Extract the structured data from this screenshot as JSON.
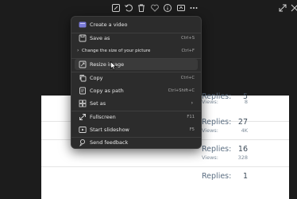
{
  "toolbar": {
    "icons": [
      "edit-icon",
      "rotate-icon",
      "delete-icon",
      "favorite-icon",
      "info-icon",
      "edit-with-icon",
      "more-icon",
      "expand-icon",
      "close-icon"
    ]
  },
  "menu": {
    "create_video": {
      "label": "Create a video",
      "icon": "video-icon"
    },
    "save_as": {
      "label": "Save as",
      "shortcut": "Ctrl+S",
      "icon": "save-icon"
    },
    "change_size": {
      "label": "Change the size of your picture",
      "shortcut": "Ctrl+F"
    },
    "resize_image": {
      "label": "Resize image",
      "icon": "resize-icon"
    },
    "copy": {
      "label": "Copy",
      "shortcut": "Ctrl+C",
      "icon": "copy-icon"
    },
    "copy_as_path": {
      "label": "Copy as path",
      "shortcut": "Ctrl+Shift+C",
      "icon": "copy-path-icon"
    },
    "set_as": {
      "label": "Set as",
      "arrow": "›",
      "icon": "set-as-icon"
    },
    "fullscreen": {
      "label": "Fullscreen",
      "shortcut": "F11",
      "icon": "fullscreen-icon"
    },
    "slideshow": {
      "label": "Start slideshow",
      "shortcut": "F5",
      "icon": "slideshow-icon"
    },
    "feedback": {
      "label": "Send feedback",
      "icon": "feedback-icon"
    }
  },
  "forum": {
    "rows": [
      {
        "replies_label": "Replies:",
        "replies": "5",
        "views_label": "Views:",
        "views": "8"
      },
      {
        "replies_label": "Replies:",
        "replies": "27",
        "views_label": "Views:",
        "views": "4K"
      },
      {
        "replies_label": "Replies:",
        "replies": "16",
        "views_label": "Views:",
        "views": "328"
      },
      {
        "replies_label": "Replies:",
        "replies": "1",
        "views_label": "Views:",
        "views": ""
      }
    ]
  },
  "colors": {
    "background": "#1c1c1c",
    "menu_bg": "#2c2c2c",
    "menu_hover": "#3a3a3a",
    "video_accent": "#7b7bd8"
  }
}
